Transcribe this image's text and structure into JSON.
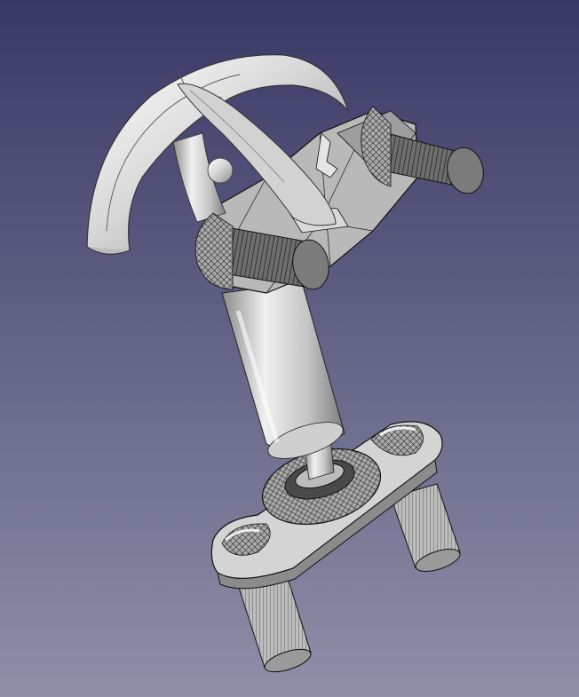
{
  "viewport": {
    "background_top": "#393966",
    "background_bottom": "#8f8fa8"
  },
  "model": {
    "body_color": "#c9c9c9",
    "highlight_color": "#f2f2f2",
    "shadow_color": "#7a7a7a",
    "edge_color": "#1a1a1a"
  }
}
